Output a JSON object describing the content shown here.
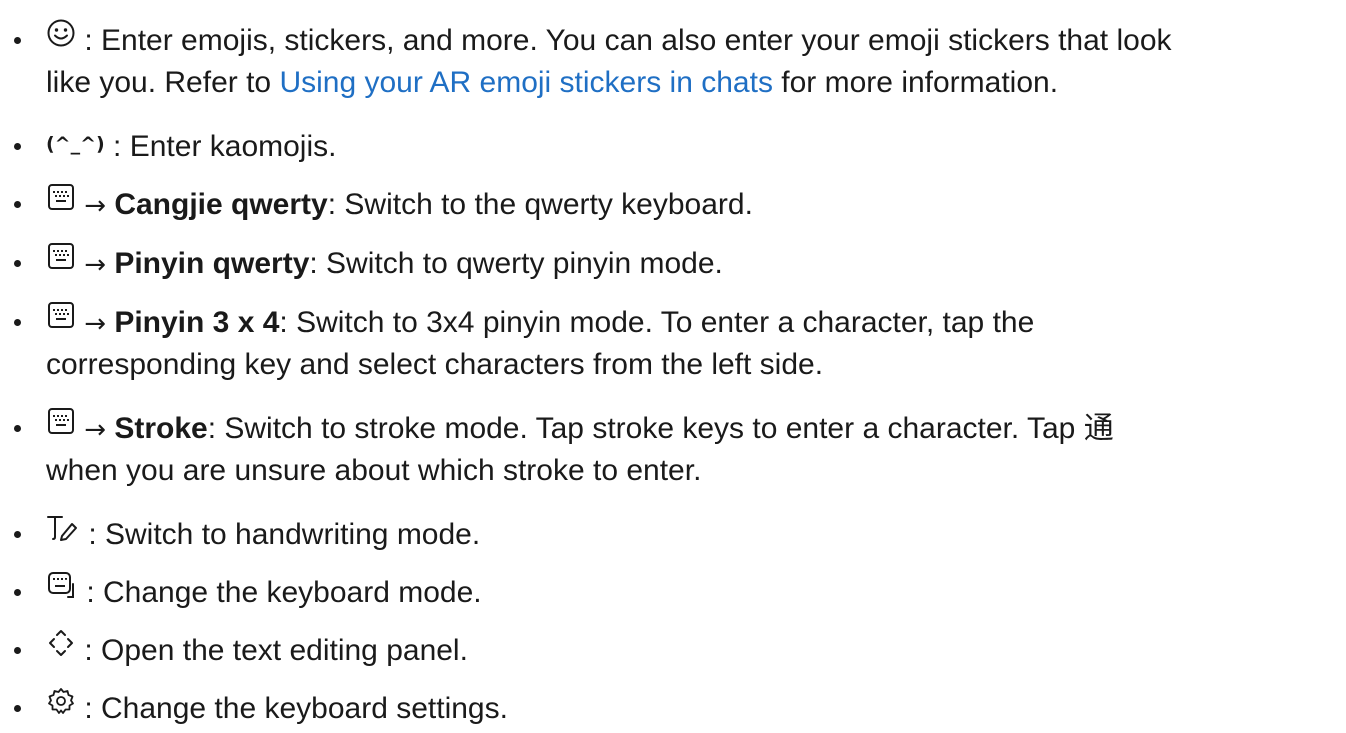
{
  "items": [
    {
      "icon": "smiley-emoji-icon",
      "line1": " : Enter emojis, stickers, and more. You can also enter your emoji stickers that look",
      "line2_pre": "like you. Refer to ",
      "link": "Using your AR emoji stickers in chats",
      "line2_post": " for more information."
    },
    {
      "kaomoji": "(^_^)",
      "text": " : Enter kaomojis."
    },
    {
      "icon": "keyboard-icon",
      "arrow": " → ",
      "bold": "Cangjie qwerty",
      "text": ": Switch to the qwerty keyboard."
    },
    {
      "icon": "keyboard-icon",
      "arrow": " → ",
      "bold": "Pinyin qwerty",
      "text": ": Switch to qwerty pinyin mode."
    },
    {
      "icon": "keyboard-icon",
      "arrow": " → ",
      "bold": "Pinyin 3 x 4",
      "text": ": Switch to 3x4 pinyin mode. To enter a character, tap the",
      "line2": "corresponding key and select characters from the left side."
    },
    {
      "icon": "keyboard-icon",
      "arrow": " → ",
      "bold": "Stroke",
      "text": ": Switch to stroke mode. Tap stroke keys to enter a character. Tap 通",
      "line2": "when you are unsure about which stroke to enter."
    },
    {
      "icon": "handwriting-icon",
      "text": " : Switch to handwriting mode."
    },
    {
      "icon": "keyboard-mode-icon",
      "text": " : Change the keyboard mode."
    },
    {
      "icon": "text-editing-icon",
      "text": " : Open the text editing panel."
    },
    {
      "icon": "settings-gear-icon",
      "text": " : Change the keyboard settings."
    }
  ],
  "colors": {
    "text": "#1a1a1a",
    "link": "#1f6fc4"
  }
}
